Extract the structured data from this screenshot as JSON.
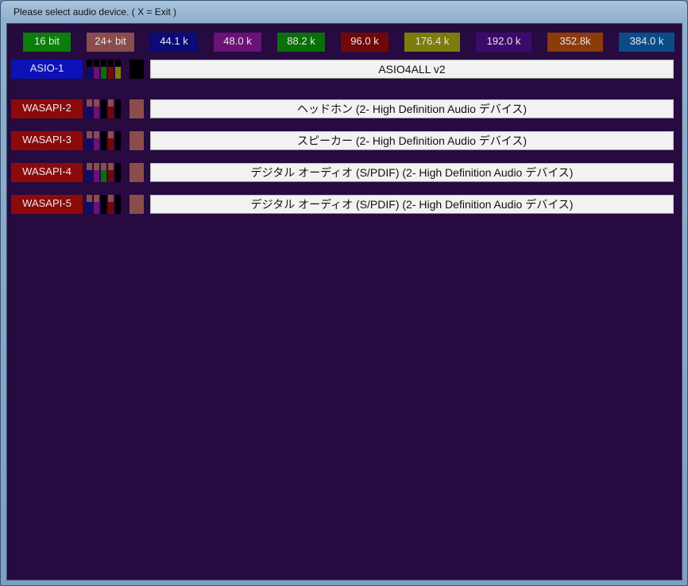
{
  "window": {
    "title": "Please select audio device.  ( X = Exit )"
  },
  "rates": [
    {
      "label": "16 bit",
      "color": "#0b7d0b"
    },
    {
      "label": "24+ bit",
      "color": "#8a4c4c"
    },
    {
      "label": "44.1 k",
      "color": "#0a0a78"
    },
    {
      "label": "48.0 k",
      "color": "#6a1278"
    },
    {
      "label": "88.2 k",
      "color": "#0a6f0a"
    },
    {
      "label": "96.0 k",
      "color": "#700808"
    },
    {
      "label": "176.4 k",
      "color": "#7c7c0c"
    },
    {
      "label": "192.0 k",
      "color": "#3b0a6c"
    },
    {
      "label": "352.8k",
      "color": "#8c3a0a"
    },
    {
      "label": "384.0 k",
      "color": "#0a4c88"
    }
  ],
  "devices": [
    {
      "label": "ASIO-1",
      "name": "ASIO4ALL v2",
      "label_color": "#0a12b8",
      "cells": [
        [
          "#000000",
          "#0a0a78"
        ],
        [
          "#000000",
          "#6a1278"
        ],
        [
          "#000000",
          "#0a6f0a"
        ],
        [
          "#000000",
          "#700808"
        ],
        [
          "#000000",
          "#7c7c0c"
        ],
        [
          "#000000",
          "#000000"
        ]
      ]
    },
    {
      "label": "WASAPI-2",
      "name": "ヘッドホン (2- High Definition Audio デバイス)",
      "label_color": "#8c0a0a",
      "cells": [
        [
          "#8a4c4c",
          "#0a0a78"
        ],
        [
          "#8a4c4c",
          "#6a1278"
        ],
        [
          "#000000",
          "#000000"
        ],
        [
          "#8a4c4c",
          "#700808"
        ],
        [
          "#000000",
          "#000000"
        ],
        [
          "#8a4c4c",
          "#3b0a6c"
        ]
      ]
    },
    {
      "label": "WASAPI-3",
      "name": "スピーカー (2- High Definition Audio デバイス)",
      "label_color": "#8c0a0a",
      "cells": [
        [
          "#8a4c4c",
          "#0a0a78"
        ],
        [
          "#8a4c4c",
          "#6a1278"
        ],
        [
          "#000000",
          "#000000"
        ],
        [
          "#8a4c4c",
          "#700808"
        ],
        [
          "#000000",
          "#000000"
        ],
        [
          "#8a4c4c",
          "#3b0a6c"
        ]
      ]
    },
    {
      "label": "WASAPI-4",
      "name": "デジタル オーディオ (S/PDIF) (2- High Definition Audio デバイス)",
      "label_color": "#8c0a0a",
      "cells": [
        [
          "#8a4c4c",
          "#0a0a78"
        ],
        [
          "#8a4c4c",
          "#6a1278"
        ],
        [
          "#8a4c4c",
          "#0a6f0a"
        ],
        [
          "#8a4c4c",
          "#700808"
        ],
        [
          "#000000",
          "#000000"
        ],
        [
          "#8a4c4c",
          "#3b0a6c"
        ]
      ]
    },
    {
      "label": "WASAPI-5",
      "name": "デジタル オーディオ (S/PDIF) (2- High Definition Audio デバイス)",
      "label_color": "#8c0a0a",
      "cells": [
        [
          "#8a4c4c",
          "#0a0a78"
        ],
        [
          "#8a4c4c",
          "#6a1278"
        ],
        [
          "#000000",
          "#000000"
        ],
        [
          "#8a4c4c",
          "#700808"
        ],
        [
          "#000000",
          "#000000"
        ],
        [
          "#8a4c4c",
          "#3b0a6c"
        ]
      ]
    }
  ]
}
